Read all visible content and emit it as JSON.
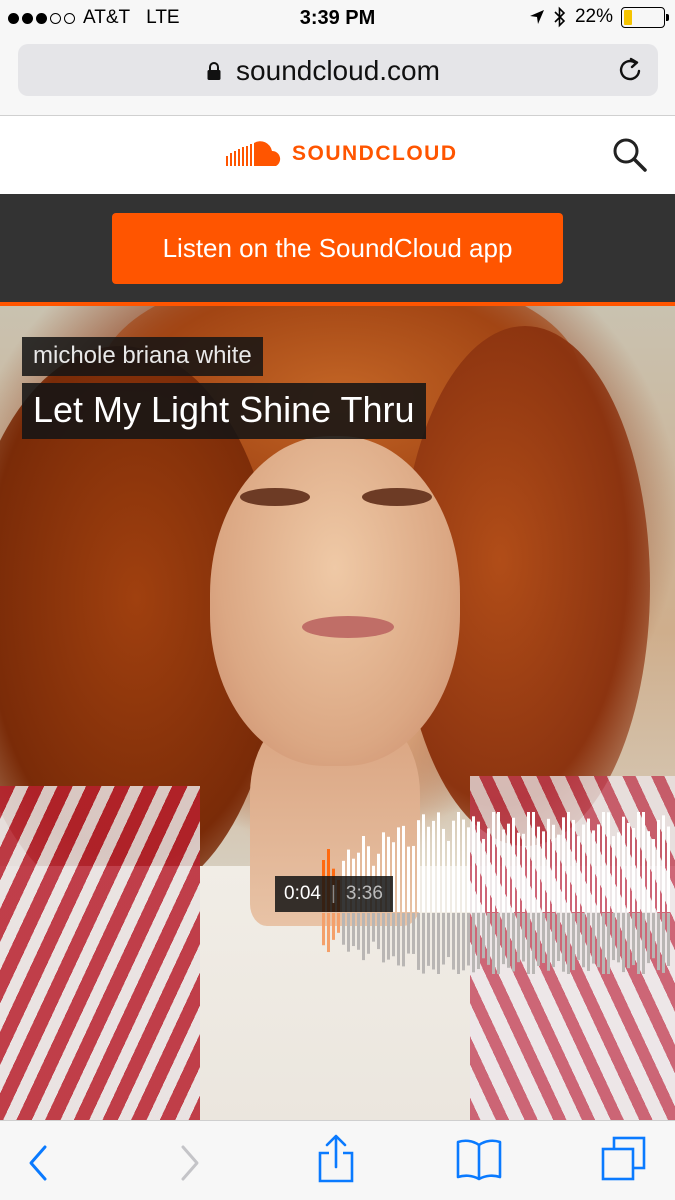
{
  "status_bar": {
    "carrier": "AT&T",
    "network": "LTE",
    "time": "3:39 PM",
    "battery": "22%",
    "battery_level": 0.22,
    "signal_bars": 3,
    "signal_total": 5
  },
  "browser": {
    "url": "soundcloud.com"
  },
  "header": {
    "logo_text": "SOUNDCLOUD",
    "brand_color": "#ff5500"
  },
  "promo": {
    "button_label": "Listen on the SoundCloud app"
  },
  "track": {
    "artist": "michole briana white",
    "title": "Let My Light Shine Thru",
    "elapsed": "0:04",
    "separator": "|",
    "duration": "3:36",
    "progress": 0.018
  },
  "toolbar": {
    "icons": [
      "back-icon",
      "forward-icon",
      "share-icon",
      "bookmarks-icon",
      "tabs-icon"
    ]
  }
}
